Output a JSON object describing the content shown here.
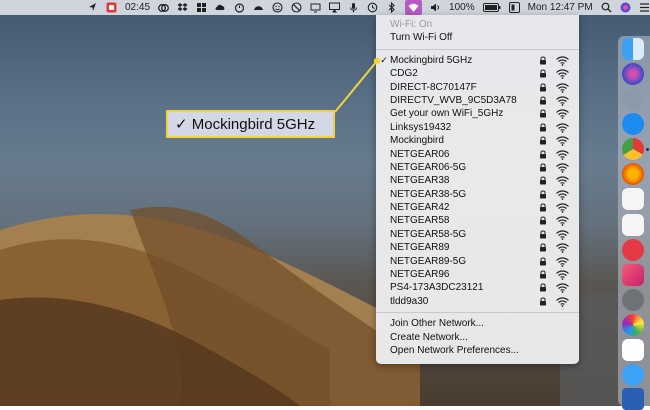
{
  "menubar": {
    "time_24": "02:45",
    "battery": "100%",
    "clock": "Mon 12:47 PM"
  },
  "wifi_menu": {
    "status": "Wi-Fi: On",
    "toggle": "Turn Wi-Fi Off",
    "networks": [
      {
        "name": "Mockingbird 5GHz",
        "checked": true,
        "locked": true
      },
      {
        "name": "CDG2",
        "checked": false,
        "locked": true
      },
      {
        "name": "DIRECT-8C70147F",
        "checked": false,
        "locked": true
      },
      {
        "name": "DIRECTV_WVB_9C5D3A78",
        "checked": false,
        "locked": true
      },
      {
        "name": "Get your own WiFi_5GHz",
        "checked": false,
        "locked": true
      },
      {
        "name": "Linksys19432",
        "checked": false,
        "locked": true
      },
      {
        "name": "Mockingbird",
        "checked": false,
        "locked": true
      },
      {
        "name": "NETGEAR06",
        "checked": false,
        "locked": true
      },
      {
        "name": "NETGEAR06-5G",
        "checked": false,
        "locked": true
      },
      {
        "name": "NETGEAR38",
        "checked": false,
        "locked": true
      },
      {
        "name": "NETGEAR38-5G",
        "checked": false,
        "locked": true
      },
      {
        "name": "NETGEAR42",
        "checked": false,
        "locked": true
      },
      {
        "name": "NETGEAR58",
        "checked": false,
        "locked": true
      },
      {
        "name": "NETGEAR58-5G",
        "checked": false,
        "locked": true
      },
      {
        "name": "NETGEAR89",
        "checked": false,
        "locked": true
      },
      {
        "name": "NETGEAR89-5G",
        "checked": false,
        "locked": true
      },
      {
        "name": "NETGEAR96",
        "checked": false,
        "locked": true
      },
      {
        "name": "PS4-173A3DC23121",
        "checked": false,
        "locked": true
      },
      {
        "name": "tldd9a30",
        "checked": false,
        "locked": true
      }
    ],
    "actions": {
      "join_other": "Join Other Network...",
      "create": "Create Network...",
      "preferences": "Open Network Preferences..."
    }
  },
  "callout": {
    "text": "✓ Mockingbird 5GHz"
  },
  "dock": {
    "icons": [
      "finder-icon",
      "siri-icon",
      "launchpad-icon",
      "app-store-icon",
      "chrome-icon",
      "firefox-icon",
      "reminders-icon",
      "news-icon",
      "music-icon",
      "settings-icon",
      "photos-icon",
      "slack-icon",
      "messages-icon",
      "word-icon"
    ]
  },
  "colors": {
    "accent": "#b65ac6",
    "callout_border": "#f3d23a",
    "callout_fill": "#d3d7e6"
  }
}
